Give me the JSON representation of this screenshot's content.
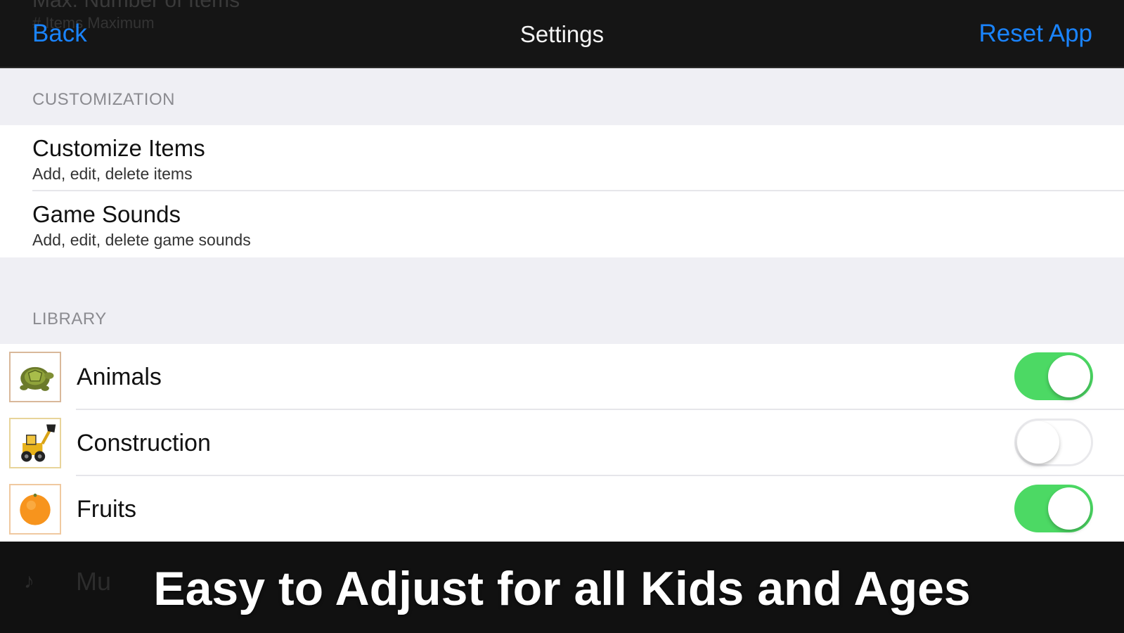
{
  "navbar": {
    "back_label": "Back",
    "title": "Settings",
    "reset_label": "Reset App",
    "ghost_title": "Max. Number of Items",
    "ghost_subtitle": "# Items Maximum"
  },
  "customization": {
    "header": "CUSTOMIZATION",
    "items": [
      {
        "title": "Customize Items",
        "subtitle": "Add, edit, delete items"
      },
      {
        "title": "Game Sounds",
        "subtitle": "Add, edit, delete game sounds"
      }
    ]
  },
  "library": {
    "header": "LIBRARY",
    "items": [
      {
        "label": "Animals",
        "icon": "turtle-icon",
        "enabled": true
      },
      {
        "label": "Construction",
        "icon": "loader-truck-icon",
        "enabled": false
      },
      {
        "label": "Fruits",
        "icon": "orange-icon",
        "enabled": true
      }
    ],
    "partially_hidden_row": "Mu"
  },
  "caption": "Easy to Adjust for all Kids and Ages",
  "colors": {
    "accent": "#1a84ff",
    "toggle_on": "#4cd964",
    "navbar_bg": "#151515",
    "group_bg": "#efeff4"
  }
}
